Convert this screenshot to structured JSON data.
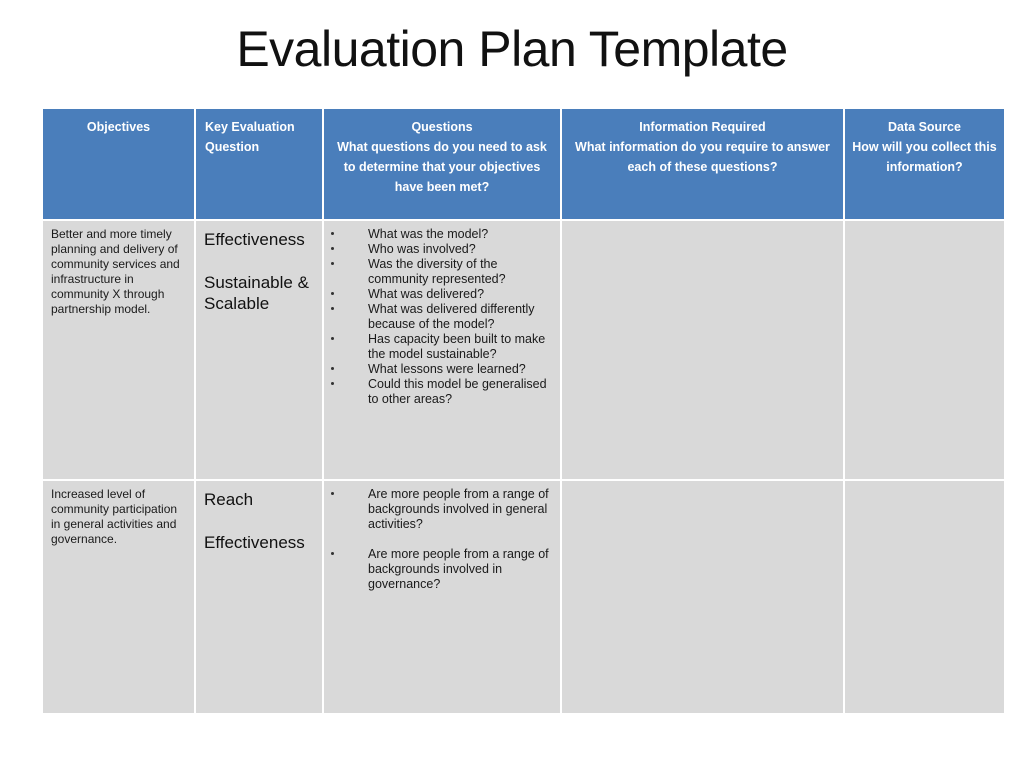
{
  "slide": {
    "title": "Evaluation Plan Template"
  },
  "colors": {
    "header_blue": "#4a7ebb",
    "cell_gray": "#d9d9d9",
    "gridline": "#ffffff",
    "text_dark": "#1a1a1a",
    "header_text": "#ffffff"
  },
  "table": {
    "headers": [
      {
        "title": "Objectives",
        "subtitle": "",
        "align": "center"
      },
      {
        "title": "Key Evaluation Question",
        "subtitle": "",
        "align": "left"
      },
      {
        "title": "Questions",
        "subtitle": "What questions do you need to ask to determine that your objectives have been met?",
        "align": "center"
      },
      {
        "title": "Information Required",
        "subtitle": "What information do you require to answer each of these questions?",
        "align": "center"
      },
      {
        "title": "Data Source",
        "subtitle": "How will you collect this information?",
        "align": "center"
      }
    ],
    "rows": [
      {
        "objective": "Better and more timely planning and delivery of community services and infrastructure in community X through partnership model.",
        "key_evaluation_questions": [
          "Effectiveness",
          "Sustainable & Scalable"
        ],
        "questions": [
          "What was the model?",
          "Who was involved?",
          "Was the diversity of the community represented?",
          "What was delivered?",
          "What was delivered differently because of the model?",
          "Has capacity been built to make the model sustainable?",
          "What lessons were learned?",
          "Could this model be generalised to other areas?"
        ],
        "questions_spaced": false,
        "information_required": "",
        "data_source": ""
      },
      {
        "objective": "Increased level of community participation in general activities and governance.",
        "key_evaluation_questions": [
          "Reach",
          "Effectiveness"
        ],
        "questions": [
          "Are more people from a range of backgrounds involved in general activities?",
          "Are more people from a range of backgrounds involved in governance?"
        ],
        "questions_spaced": true,
        "information_required": "",
        "data_source": ""
      }
    ]
  }
}
